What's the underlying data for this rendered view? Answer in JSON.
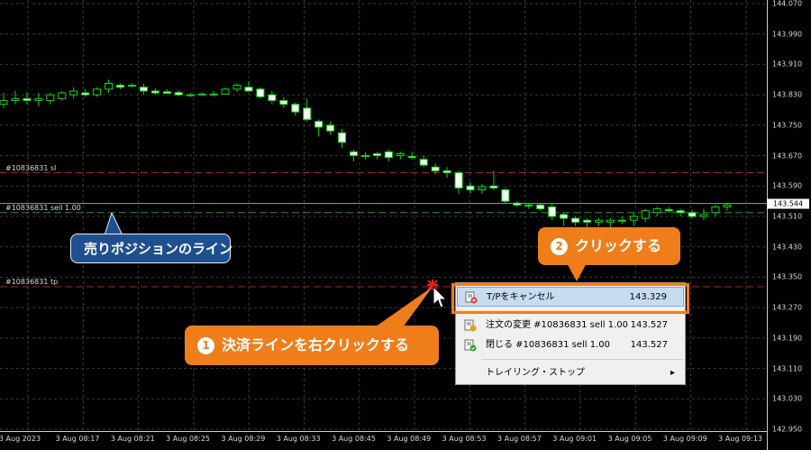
{
  "chart": {
    "price_ticks": [
      "144.070",
      "143.990",
      "143.910",
      "143.830",
      "143.750",
      "143.670",
      "143.590",
      "143.510",
      "143.430",
      "143.350",
      "143.270",
      "143.190",
      "143.110",
      "143.030",
      "142.950"
    ],
    "time_ticks": [
      "3 Aug 2023",
      "3 Aug 08:17",
      "3 Aug 08:21",
      "3 Aug 08:25",
      "3 Aug 08:29",
      "3 Aug 08:33",
      "3 Aug 08:45",
      "3 Aug 08:49",
      "3 Aug 08:53",
      "3 Aug 08:57",
      "3 Aug 09:01",
      "3 Aug 09:05",
      "3 Aug 09:09",
      "3 Aug 09:13"
    ],
    "current_price": "143.544",
    "level_labels": {
      "sl": "#10836831 sl",
      "entry": "#10836831 sell 1.00",
      "tp": "#10836831 tp"
    },
    "colors": {
      "background": "#000000",
      "grid": "#3a3a3a",
      "candle": "#00e000",
      "bear_body": "#ffffff",
      "sl_tp_line": "#c01818",
      "entry_line": "#1f9a1f"
    }
  },
  "chart_data": {
    "type": "candlestick",
    "series_values": [
      {
        "o": 143.805,
        "h": 143.835,
        "l": 143.795,
        "c": 143.815
      },
      {
        "o": 143.815,
        "h": 143.84,
        "l": 143.805,
        "c": 143.82
      },
      {
        "o": 143.82,
        "h": 143.835,
        "l": 143.805,
        "c": 143.815
      },
      {
        "o": 143.815,
        "h": 143.835,
        "l": 143.8,
        "c": 143.82
      },
      {
        "o": 143.815,
        "h": 143.835,
        "l": 143.805,
        "c": 143.83
      },
      {
        "o": 143.82,
        "h": 143.84,
        "l": 143.815,
        "c": 143.835
      },
      {
        "o": 143.83,
        "h": 143.85,
        "l": 143.82,
        "c": 143.84
      },
      {
        "o": 143.835,
        "h": 143.845,
        "l": 143.825,
        "c": 143.83
      },
      {
        "o": 143.83,
        "h": 143.85,
        "l": 143.825,
        "c": 143.845
      },
      {
        "o": 143.845,
        "h": 143.87,
        "l": 143.835,
        "c": 143.86
      },
      {
        "o": 143.855,
        "h": 143.86,
        "l": 143.845,
        "c": 143.85
      },
      {
        "o": 143.855,
        "h": 143.86,
        "l": 143.85,
        "c": 143.855
      },
      {
        "o": 143.85,
        "h": 143.86,
        "l": 143.83,
        "c": 143.84
      },
      {
        "o": 143.84,
        "h": 143.848,
        "l": 143.83,
        "c": 143.835
      },
      {
        "o": 143.838,
        "h": 143.845,
        "l": 143.832,
        "c": 143.834
      },
      {
        "o": 143.836,
        "h": 143.842,
        "l": 143.826,
        "c": 143.83
      },
      {
        "o": 143.83,
        "h": 143.835,
        "l": 143.825,
        "c": 143.828
      },
      {
        "o": 143.83,
        "h": 143.836,
        "l": 143.828,
        "c": 143.832
      },
      {
        "o": 143.832,
        "h": 143.84,
        "l": 143.825,
        "c": 143.83
      },
      {
        "o": 143.832,
        "h": 143.85,
        "l": 143.83,
        "c": 143.845
      },
      {
        "o": 143.845,
        "h": 143.86,
        "l": 143.838,
        "c": 143.855
      },
      {
        "o": 143.85,
        "h": 143.865,
        "l": 143.84,
        "c": 143.84
      },
      {
        "o": 143.845,
        "h": 143.85,
        "l": 143.82,
        "c": 143.825
      },
      {
        "o": 143.83,
        "h": 143.84,
        "l": 143.805,
        "c": 143.815
      },
      {
        "o": 143.815,
        "h": 143.825,
        "l": 143.795,
        "c": 143.805
      },
      {
        "o": 143.805,
        "h": 143.81,
        "l": 143.775,
        "c": 143.785
      },
      {
        "o": 143.795,
        "h": 143.82,
        "l": 143.76,
        "c": 143.765
      },
      {
        "o": 143.76,
        "h": 143.765,
        "l": 143.72,
        "c": 143.745
      },
      {
        "o": 143.75,
        "h": 143.76,
        "l": 143.725,
        "c": 143.735
      },
      {
        "o": 143.73,
        "h": 143.74,
        "l": 143.69,
        "c": 143.705
      },
      {
        "o": 143.68,
        "h": 143.685,
        "l": 143.655,
        "c": 143.67
      },
      {
        "o": 143.67,
        "h": 143.68,
        "l": 143.66,
        "c": 143.67
      },
      {
        "o": 143.675,
        "h": 143.68,
        "l": 143.66,
        "c": 143.67
      },
      {
        "o": 143.68,
        "h": 143.685,
        "l": 143.655,
        "c": 143.665
      },
      {
        "o": 143.67,
        "h": 143.68,
        "l": 143.66,
        "c": 143.675
      },
      {
        "o": 143.668,
        "h": 143.68,
        "l": 143.66,
        "c": 143.665
      },
      {
        "o": 143.66,
        "h": 143.67,
        "l": 143.64,
        "c": 143.645
      },
      {
        "o": 143.64,
        "h": 143.65,
        "l": 143.62,
        "c": 143.63
      },
      {
        "o": 143.63,
        "h": 143.64,
        "l": 143.612,
        "c": 143.625
      },
      {
        "o": 143.625,
        "h": 143.63,
        "l": 143.57,
        "c": 143.585
      },
      {
        "o": 143.59,
        "h": 143.6,
        "l": 143.57,
        "c": 143.58
      },
      {
        "o": 143.58,
        "h": 143.595,
        "l": 143.57,
        "c": 143.588
      },
      {
        "o": 143.59,
        "h": 143.63,
        "l": 143.58,
        "c": 143.585
      },
      {
        "o": 143.58,
        "h": 143.585,
        "l": 143.545,
        "c": 143.55
      },
      {
        "o": 143.545,
        "h": 143.55,
        "l": 143.535,
        "c": 143.54
      },
      {
        "o": 143.54,
        "h": 143.545,
        "l": 143.53,
        "c": 143.538
      },
      {
        "o": 143.54,
        "h": 143.545,
        "l": 143.525,
        "c": 143.53
      },
      {
        "o": 143.535,
        "h": 143.545,
        "l": 143.5,
        "c": 143.51
      },
      {
        "o": 143.515,
        "h": 143.52,
        "l": 143.485,
        "c": 143.505
      },
      {
        "o": 143.505,
        "h": 143.51,
        "l": 143.485,
        "c": 143.495
      },
      {
        "o": 143.5,
        "h": 143.505,
        "l": 143.48,
        "c": 143.495
      },
      {
        "o": 143.495,
        "h": 143.505,
        "l": 143.485,
        "c": 143.5
      },
      {
        "o": 143.495,
        "h": 143.505,
        "l": 143.475,
        "c": 143.5
      },
      {
        "o": 143.5,
        "h": 143.51,
        "l": 143.49,
        "c": 143.498
      },
      {
        "o": 143.5,
        "h": 143.52,
        "l": 143.485,
        "c": 143.51
      },
      {
        "o": 143.505,
        "h": 143.53,
        "l": 143.495,
        "c": 143.525
      },
      {
        "o": 143.52,
        "h": 143.535,
        "l": 143.51,
        "c": 143.53
      },
      {
        "o": 143.528,
        "h": 143.535,
        "l": 143.52,
        "c": 143.525
      },
      {
        "o": 143.525,
        "h": 143.53,
        "l": 143.51,
        "c": 143.52
      },
      {
        "o": 143.52,
        "h": 143.528,
        "l": 143.505,
        "c": 143.51
      },
      {
        "o": 143.51,
        "h": 143.53,
        "l": 143.5,
        "c": 143.515
      },
      {
        "o": 143.52,
        "h": 143.54,
        "l": 143.51,
        "c": 143.535
      },
      {
        "o": 143.535,
        "h": 143.545,
        "l": 143.525,
        "c": 143.54
      }
    ],
    "ylim": [
      142.95,
      144.07
    ],
    "levels": {
      "sl": 143.625,
      "entry": 143.52,
      "tp": 143.325
    },
    "grid": true
  },
  "annotations": {
    "blue_label": "売りポジションのライン",
    "step1_num": "1",
    "step1_text": "決済ラインを右クリックする",
    "step2_num": "2",
    "step2_text": "クリックする"
  },
  "context_menu": {
    "items": [
      {
        "label": "T/Pをキャンセル",
        "value": "143.329",
        "icon": "cancel-tp-icon"
      },
      {
        "label": "注文の変更 #10836831 sell 1.00",
        "value": "143.527",
        "icon": "modify-order-icon"
      },
      {
        "label": "閉じる #10836831 sell 1.00",
        "value": "143.527",
        "icon": "close-order-icon"
      },
      {
        "label": "トレイリング・ストップ",
        "value": "",
        "icon": "submenu-arrow-icon"
      }
    ],
    "submenu_arrow": "▸"
  }
}
